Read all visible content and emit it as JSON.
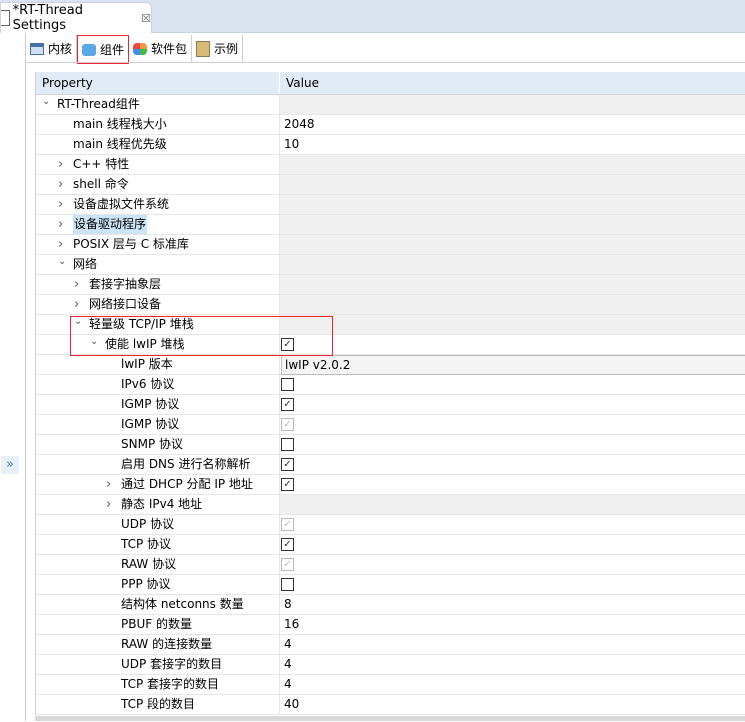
{
  "editor_tab": {
    "title": "*RT-Thread Settings",
    "close": "☒"
  },
  "subtabs": [
    {
      "label": "内核",
      "icon": "table-icon"
    },
    {
      "label": "组件",
      "icon": "cube-icon"
    },
    {
      "label": "软件包",
      "icon": "packages-icon"
    },
    {
      "label": "示例",
      "icon": "clipboard-icon"
    }
  ],
  "side_toggle": "»",
  "table": {
    "headers": {
      "property": "Property",
      "value": "Value"
    },
    "rows": [
      {
        "label": "RT-Thread组件",
        "level": 0,
        "exp": "open",
        "kind": "none"
      },
      {
        "label": "main 线程栈大小",
        "level": 1,
        "exp": "",
        "kind": "text",
        "value": "2048"
      },
      {
        "label": "main 线程优先级",
        "level": 1,
        "exp": "",
        "kind": "text",
        "value": "10"
      },
      {
        "label": "C++ 特性",
        "level": 1,
        "exp": "closed",
        "kind": "none"
      },
      {
        "label": "shell 命令",
        "level": 1,
        "exp": "closed",
        "kind": "none"
      },
      {
        "label": "设备虚拟文件系统",
        "level": 1,
        "exp": "closed",
        "kind": "none"
      },
      {
        "label": "设备驱动程序",
        "level": 1,
        "exp": "closed",
        "kind": "none",
        "selected": true
      },
      {
        "label": "POSIX 层与 C 标准库",
        "level": 1,
        "exp": "closed",
        "kind": "none"
      },
      {
        "label": "网络",
        "level": 1,
        "exp": "open",
        "kind": "none"
      },
      {
        "label": "套接字抽象层",
        "level": 2,
        "exp": "closed",
        "kind": "none"
      },
      {
        "label": "网络接口设备",
        "level": 2,
        "exp": "closed",
        "kind": "none"
      },
      {
        "label": "轻量级 TCP/IP 堆栈",
        "level": 2,
        "exp": "open",
        "kind": "none"
      },
      {
        "label": "使能 lwIP 堆栈",
        "level": 3,
        "exp": "open",
        "kind": "check",
        "checked": true
      },
      {
        "label": "lwIP 版本",
        "level": 4,
        "exp": "",
        "kind": "select",
        "value": "lwIP v2.0.2"
      },
      {
        "label": "IPv6 协议",
        "level": 4,
        "exp": "",
        "kind": "check",
        "checked": false
      },
      {
        "label": "IGMP 协议",
        "level": 4,
        "exp": "",
        "kind": "check",
        "checked": true
      },
      {
        "label": "IGMP 协议",
        "level": 4,
        "exp": "",
        "kind": "check",
        "checked": true,
        "disabled": true
      },
      {
        "label": "SNMP 协议",
        "level": 4,
        "exp": "",
        "kind": "check",
        "checked": false
      },
      {
        "label": "启用 DNS 进行名称解析",
        "level": 4,
        "exp": "",
        "kind": "check",
        "checked": true
      },
      {
        "label": "通过 DHCP 分配 IP 地址",
        "level": 4,
        "exp": "closed",
        "kind": "check",
        "checked": true
      },
      {
        "label": "静态 IPv4 地址",
        "level": 4,
        "exp": "closed",
        "kind": "none"
      },
      {
        "label": "UDP 协议",
        "level": 4,
        "exp": "",
        "kind": "check",
        "checked": true,
        "disabled": true
      },
      {
        "label": "TCP 协议",
        "level": 4,
        "exp": "",
        "kind": "check",
        "checked": true
      },
      {
        "label": "RAW 协议",
        "level": 4,
        "exp": "",
        "kind": "check",
        "checked": true,
        "disabled": true
      },
      {
        "label": "PPP 协议",
        "level": 4,
        "exp": "",
        "kind": "check",
        "checked": false
      },
      {
        "label": "结构体 netconns 数量",
        "level": 4,
        "exp": "",
        "kind": "text",
        "value": "8"
      },
      {
        "label": "PBUF 的数量",
        "level": 4,
        "exp": "",
        "kind": "text",
        "value": "16"
      },
      {
        "label": "RAW 的连接数量",
        "level": 4,
        "exp": "",
        "kind": "text",
        "value": "4"
      },
      {
        "label": "UDP 套接字的数目",
        "level": 4,
        "exp": "",
        "kind": "text",
        "value": "4"
      },
      {
        "label": "TCP 套接字的数目",
        "level": 4,
        "exp": "",
        "kind": "text",
        "value": "4"
      },
      {
        "label": "TCP 段的数目",
        "level": 4,
        "exp": "",
        "kind": "text",
        "value": "40"
      }
    ]
  }
}
